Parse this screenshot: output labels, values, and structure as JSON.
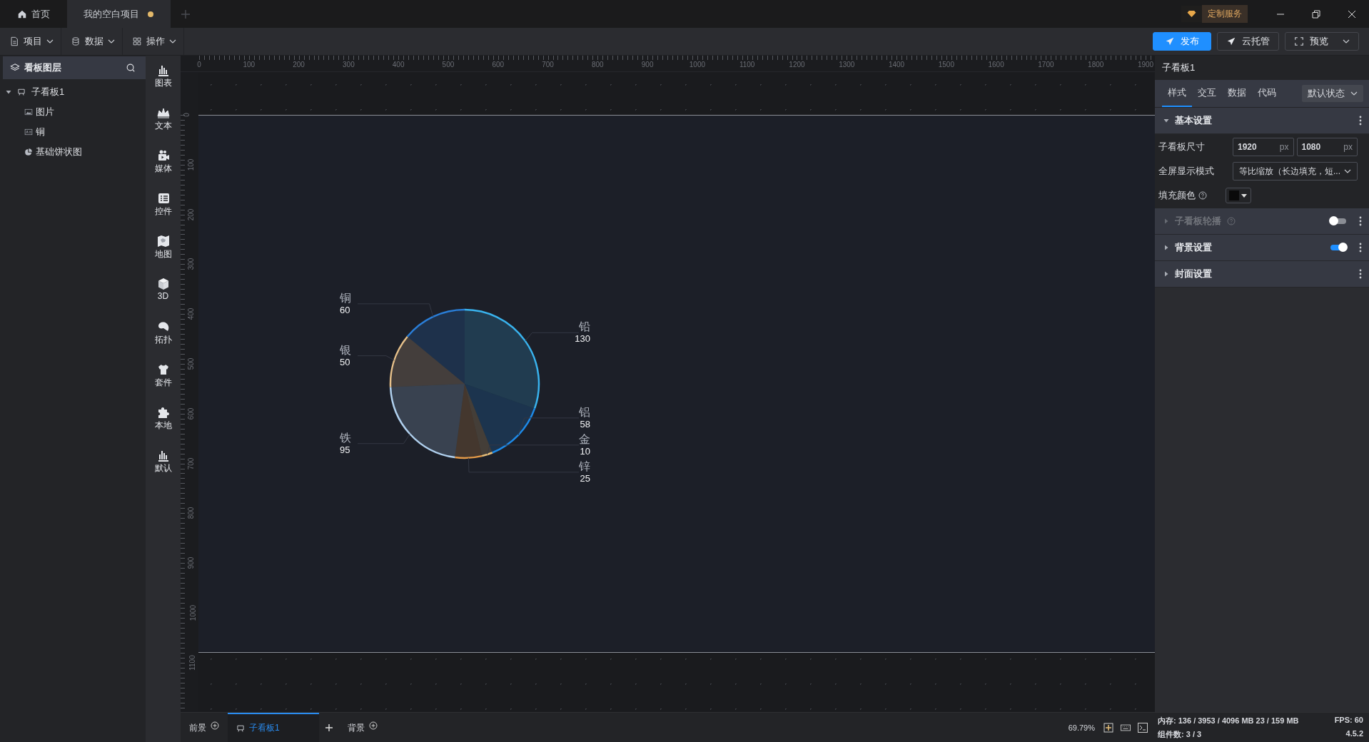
{
  "tabs": [
    {
      "label": "首页",
      "kind": "home",
      "selected": false,
      "modified": false
    },
    {
      "label": "我的空白项目",
      "kind": "project",
      "selected": true,
      "modified": true
    }
  ],
  "custom_service": "定制服务",
  "menus": [
    {
      "label": "项目",
      "kind": "file"
    },
    {
      "label": "数据",
      "kind": "database"
    },
    {
      "label": "操作",
      "kind": "grid"
    }
  ],
  "actions": [
    {
      "label": "发布",
      "kind": "primary"
    },
    {
      "label": "云托管",
      "kind": "secondary"
    },
    {
      "label": "预览",
      "kind": "dropdown"
    }
  ],
  "layers": {
    "title": "看板图层",
    "tree": [
      {
        "label": "子看板1",
        "kind": "board",
        "expanded": true,
        "children": [
          {
            "label": "图片",
            "kind": "image"
          },
          {
            "label": "铜",
            "kind": "text"
          },
          {
            "label": "基础饼状图",
            "kind": "pie"
          }
        ]
      }
    ]
  },
  "toolbox": [
    {
      "label": "图表",
      "kind": "chart"
    },
    {
      "label": "文本",
      "kind": "text"
    },
    {
      "label": "媒体",
      "kind": "media"
    },
    {
      "label": "控件",
      "kind": "control"
    },
    {
      "label": "地图",
      "kind": "map"
    },
    {
      "label": "3D",
      "kind": "cube"
    },
    {
      "label": "拓扑",
      "kind": "topology"
    },
    {
      "label": "套件",
      "kind": "kit"
    },
    {
      "label": "本地",
      "kind": "local"
    },
    {
      "label": "默认",
      "kind": "chart"
    }
  ],
  "rulers": {
    "horizontal": [
      "0",
      "100",
      "200",
      "300",
      "400",
      "500",
      "600",
      "700",
      "800",
      "900",
      "1000",
      "1100",
      "1200",
      "1300",
      "1400",
      "1500",
      "1600",
      "1700",
      "1800",
      "1900"
    ],
    "vertical": [
      "0",
      "100",
      "200",
      "300",
      "400",
      "500",
      "600",
      "700",
      "800",
      "900",
      "1000",
      "1100"
    ]
  },
  "canvas": {
    "chart_data": {
      "type": "pie",
      "categories": [
        "铅",
        "铝",
        "金",
        "锌",
        "铁",
        "银",
        "铜"
      ],
      "values": [
        130,
        58,
        10,
        25,
        95,
        50,
        60
      ],
      "colors": [
        "#39b3ee",
        "#1d8ae8",
        "#e8c07a",
        "#e49a48",
        "#b0d0ee",
        "#e6c08a",
        "#2a7ed8"
      ],
      "data_labels": true
    }
  },
  "scenes": [
    {
      "label": "前景",
      "kind": "layer",
      "selected": false
    },
    {
      "label": "子看板1",
      "kind": "board",
      "selected": true
    },
    {
      "label": "背景",
      "kind": "layer",
      "selected": false
    }
  ],
  "zoom": "69.79%",
  "status": {
    "memory": "内存: 136 / 3953 / 4096 MB  23 / 159 MB",
    "fps": "FPS: 60",
    "components": "组件数: 3 / 3",
    "version": "4.5.2"
  },
  "inspector": {
    "title": "子看板1",
    "tabs": [
      {
        "label": "样式",
        "selected": true
      },
      {
        "label": "交互",
        "selected": false
      },
      {
        "label": "数据",
        "selected": false
      },
      {
        "label": "代码",
        "selected": false
      }
    ],
    "state_select": "默认状态",
    "sections": [
      {
        "title": "基本设置",
        "expanded": true,
        "disabled": false,
        "help": false,
        "kind": "plain",
        "fields": [
          {
            "label": "子看板尺寸",
            "kind": "size",
            "help": false,
            "values": [
              {
                "value": "1920",
                "unit": "px"
              },
              {
                "value": "1080",
                "unit": "px"
              }
            ]
          },
          {
            "label": "全屏显示模式",
            "kind": "select",
            "help": false,
            "value": "等比缩放（长边填充，短..."
          },
          {
            "label": "填充颜色",
            "kind": "color",
            "help": true,
            "color": "#0a0a0a"
          }
        ]
      },
      {
        "title": "子看板轮播",
        "expanded": false,
        "disabled": true,
        "help": true,
        "kind": "toggle",
        "on": false
      },
      {
        "title": "背景设置",
        "expanded": false,
        "disabled": false,
        "help": false,
        "kind": "toggle",
        "on": true
      },
      {
        "title": "封面设置",
        "expanded": false,
        "disabled": false,
        "help": false,
        "kind": "plain"
      }
    ]
  }
}
